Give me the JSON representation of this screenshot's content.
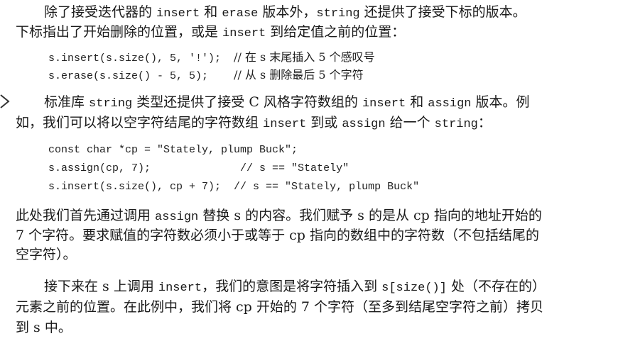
{
  "p1": {
    "l1": [
      "除了接受迭代器的 ",
      "insert",
      " 和 ",
      "erase",
      " 版本外，",
      "string",
      " 还提供了接受下标的版本。"
    ],
    "l2": [
      "下标指出了开始删除的位置，或是 ",
      "insert",
      " 到给定值之前的位置："
    ]
  },
  "code1": [
    {
      "code": "s.insert(s.size(), 5, '!');  ",
      "comment": "// 在 s 末尾插入 5 个感叹号"
    },
    {
      "code": "s.erase(s.size() - 5, 5);    ",
      "comment": "// 从 s 删除最后 5 个字符"
    }
  ],
  "p2": {
    "l1": [
      "标准库 ",
      "string",
      " 类型还提供了接受 C 风格字符数组的 ",
      "insert",
      " 和 ",
      "assign",
      " 版本。例"
    ],
    "l2": [
      "如，我们可以将以空字符结尾的字符数组 ",
      "insert",
      " 到或 ",
      "assign",
      " 给一个 ",
      "string",
      "："
    ]
  },
  "code2": [
    "const char *cp = \"Stately, plump Buck\";",
    "s.assign(cp, 7);              // s == \"Stately\"",
    "s.insert(s.size(), cp + 7);  // s == \"Stately, plump Buck\""
  ],
  "p3": {
    "l1": [
      "此处我们首先通过调用 ",
      "assign",
      " 替换 s 的内容。我们赋予 s 的是从 cp 指向的地址开始的"
    ],
    "l2": "7 个字符。要求赋值的字符数必须小于或等于 cp 指向的数组中的字符数（不包括结尾的",
    "l3": "空字符）。"
  },
  "p4": {
    "l1": [
      "接下来在 s 上调用 ",
      "insert",
      "，我们的意图是将字符插入到 ",
      "s[size()]",
      " 处（不存在的）"
    ],
    "l2": "元素之前的位置。在此例中，我们将 cp 开始的 7 个字符（至多到结尾空字符之前）拷贝",
    "l3": "到 s 中。"
  }
}
